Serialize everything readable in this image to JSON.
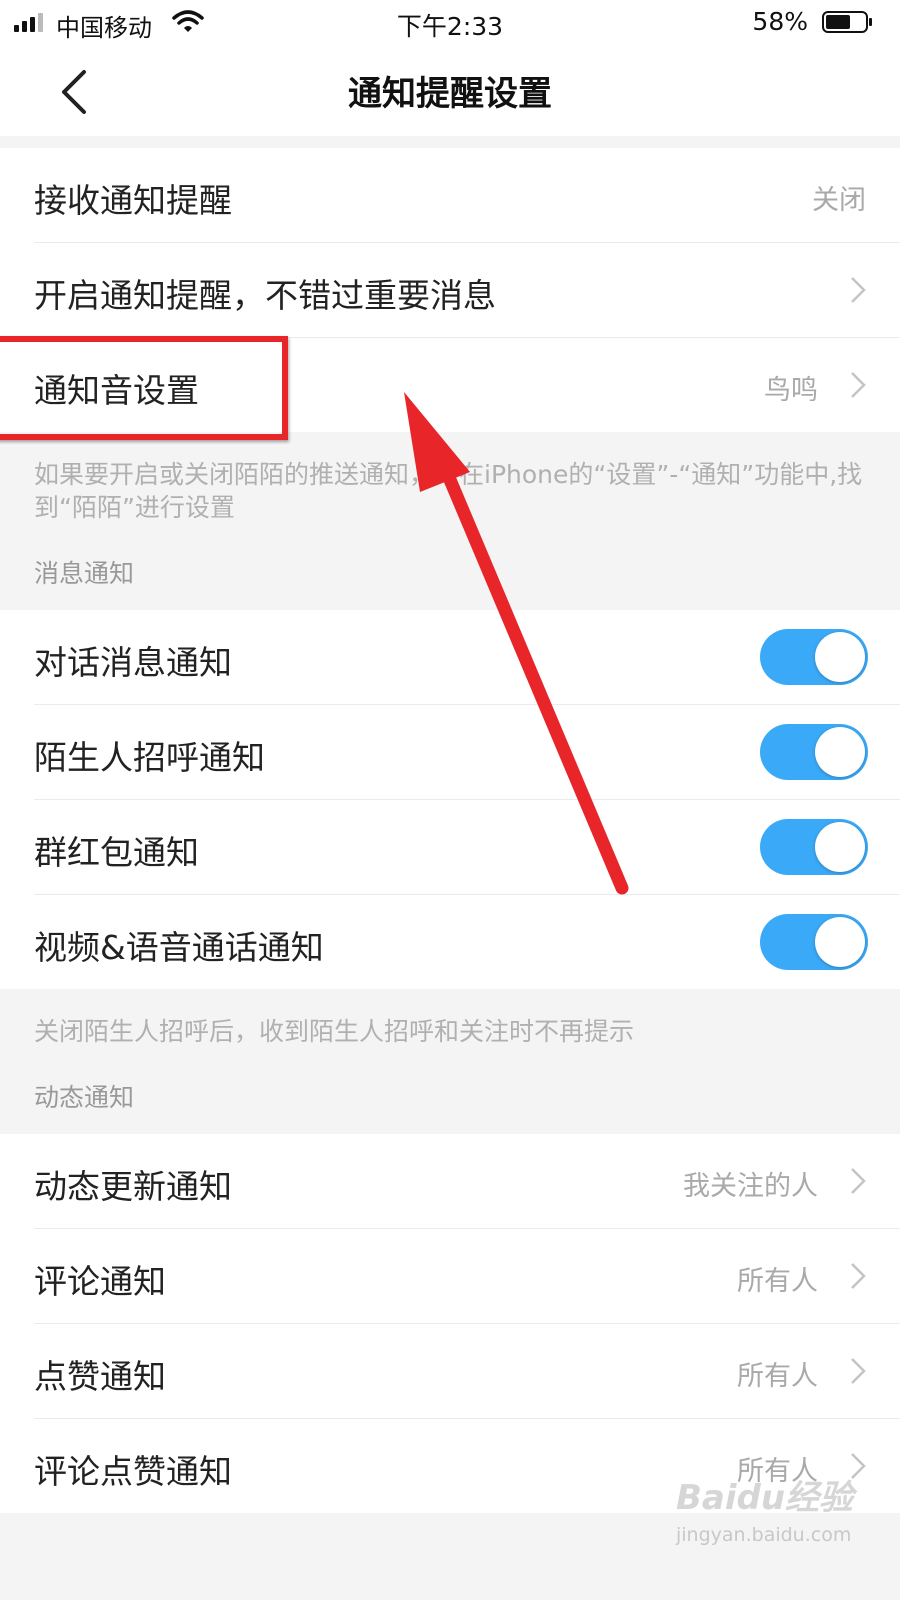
{
  "status_bar": {
    "carrier": "中国移动",
    "time": "下午2:33",
    "battery": "58%"
  },
  "nav": {
    "title": "通知提醒设置"
  },
  "group1": {
    "rows": [
      {
        "label": "接收通知提醒",
        "value": "关闭"
      },
      {
        "label": "开启通知提醒，不错过重要消息"
      },
      {
        "label": "通知音设置",
        "value": "鸟鸣"
      }
    ],
    "note": "如果要开启或关闭陌陌的推送通知，请在iPhone的“设置”-“通知”功能中,找到“陌陌”进行设置"
  },
  "message_section": {
    "header": "消息通知",
    "rows": [
      {
        "label": "对话消息通知",
        "enabled": true
      },
      {
        "label": "陌生人招呼通知",
        "enabled": true
      },
      {
        "label": "群红包通知",
        "enabled": true
      },
      {
        "label": "视频&语音通话通知",
        "enabled": true
      }
    ],
    "note": "关闭陌生人招呼后，收到陌生人招呼和关注时不再提示"
  },
  "feed_section": {
    "header": "动态通知",
    "rows": [
      {
        "label": "动态更新通知",
        "value": "我关注的人"
      },
      {
        "label": "评论通知",
        "value": "所有人"
      },
      {
        "label": "点赞通知",
        "value": "所有人"
      },
      {
        "label": "评论点赞通知",
        "value": "所有人"
      }
    ]
  },
  "watermark": {
    "logo": "Baidu经验",
    "site": "jingyan.baidu.com"
  },
  "colors": {
    "toggle_on": "#3aa9f7",
    "annotation_red": "#e8262a"
  }
}
